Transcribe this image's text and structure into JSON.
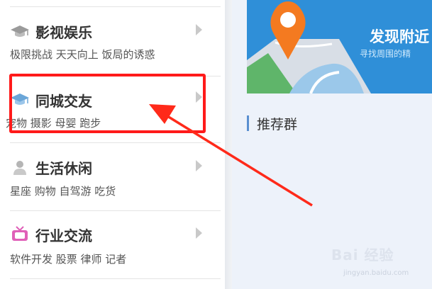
{
  "categories": [
    {
      "title": "影视娱乐",
      "subtitle": "极限挑战 天天向上 饭局的诱惑",
      "icon": "graduation-cap-icon"
    },
    {
      "title": "同城交友",
      "subtitle": "宠物 摄影 母婴 跑步",
      "icon": "graduation-cap-icon"
    },
    {
      "title": "生活休闲",
      "subtitle": "星座 购物 自驾游 吃货",
      "icon": "person-icon"
    },
    {
      "title": "行业交流",
      "subtitle": "软件开发 股票 律师 记者",
      "icon": "tv-icon"
    }
  ],
  "banner": {
    "title": "发现附近",
    "subtitle": "寻找周围的精"
  },
  "recommend": {
    "title": "推荐群"
  },
  "watermark": {
    "brand": "Bai 经验",
    "url": "jingyan.baidu.com"
  },
  "colors": {
    "accent": "#ff1a1a",
    "banner_blue": "#2f8fd8",
    "pin_orange": "#f47a20"
  }
}
